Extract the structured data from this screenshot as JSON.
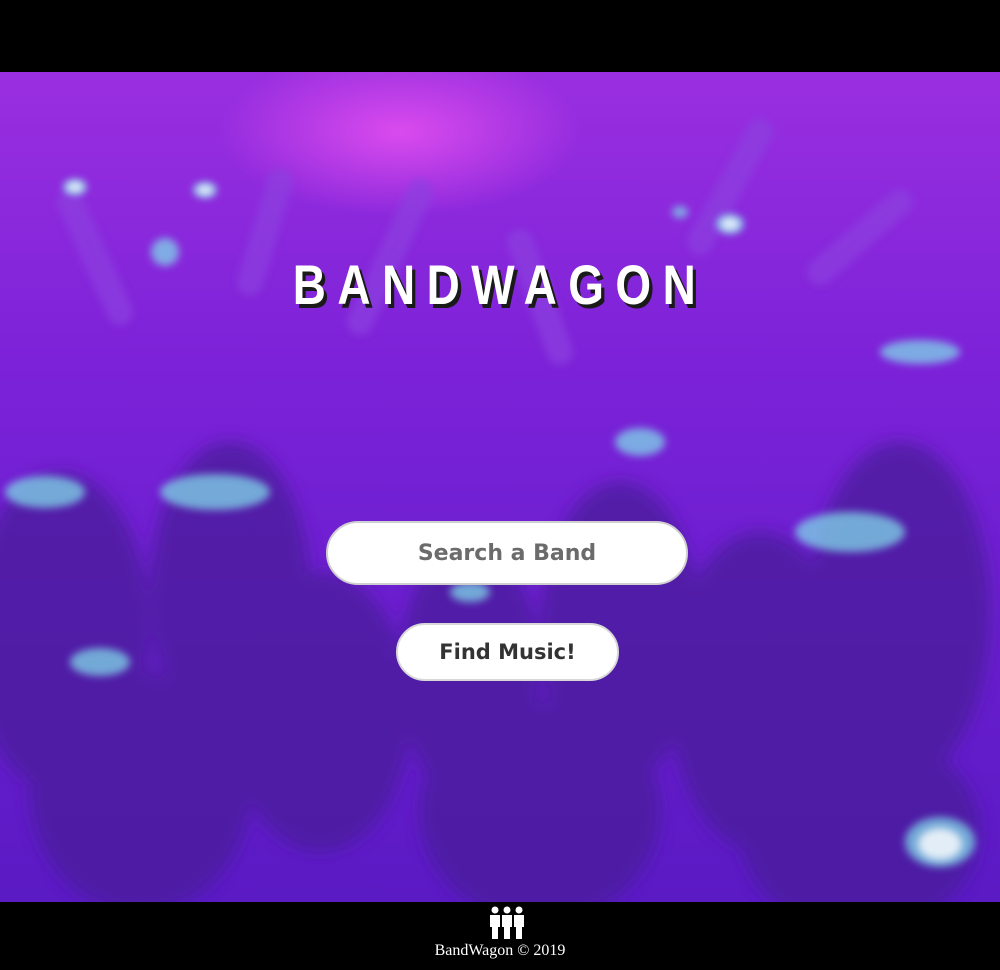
{
  "header": {
    "title": "BANDWAGON"
  },
  "search": {
    "placeholder": "Search a Band",
    "value": ""
  },
  "actions": {
    "find_label": "Find Music!"
  },
  "footer": {
    "icon": "group-of-people-icon",
    "text": "BandWagon © 2019"
  },
  "colors": {
    "hero_purple": "#7c22d8",
    "hero_glow": "#e650f0",
    "bar_black": "#000000"
  }
}
